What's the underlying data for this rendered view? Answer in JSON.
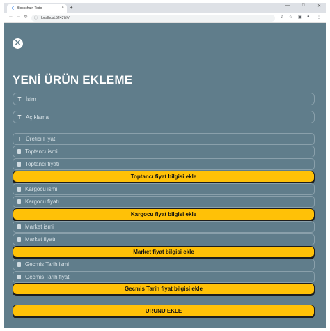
{
  "browser": {
    "tab_title": "Blockchain Todo",
    "tab_close": "×",
    "new_tab": "+",
    "url": "localhost:52437/#/",
    "back_icon": "arrow-left-icon",
    "forward_icon": "arrow-right-icon",
    "reload_icon": "reload-icon"
  },
  "page": {
    "close_glyph": "✕",
    "title": "YENİ ÜRÜN EKLEME"
  },
  "form": {
    "name_placeholder": "İsim",
    "description_placeholder": "Açıklama",
    "producer_price_placeholder": "Üretici Fiyatı",
    "wholesaler_name_placeholder": "Toptancı  ismi",
    "wholesaler_price_placeholder": "Toptancı  fiyatı",
    "add_wholesaler_label": "Toptancı  fiyat bilgisi ekle",
    "courier_name_placeholder": "Kargocu  ismi",
    "courier_price_placeholder": "Kargocu  fiyatı",
    "add_courier_label": "Kargocu  fiyat bilgisi ekle",
    "market_name_placeholder": "Market  ismi",
    "market_price_placeholder": "Market  fiyatı",
    "add_market_label": "Market  fiyat bilgisi ekle",
    "history_name_placeholder": "Gecmis Tarih  ismi",
    "history_price_placeholder": "Gecmis Tarih  fiyatı",
    "add_history_label": "Gecmis Tarih  fiyat bilgisi ekle",
    "submit_label": "URUNU EKLE"
  },
  "colors": {
    "background": "#607d8b",
    "accent": "#ffc107"
  }
}
